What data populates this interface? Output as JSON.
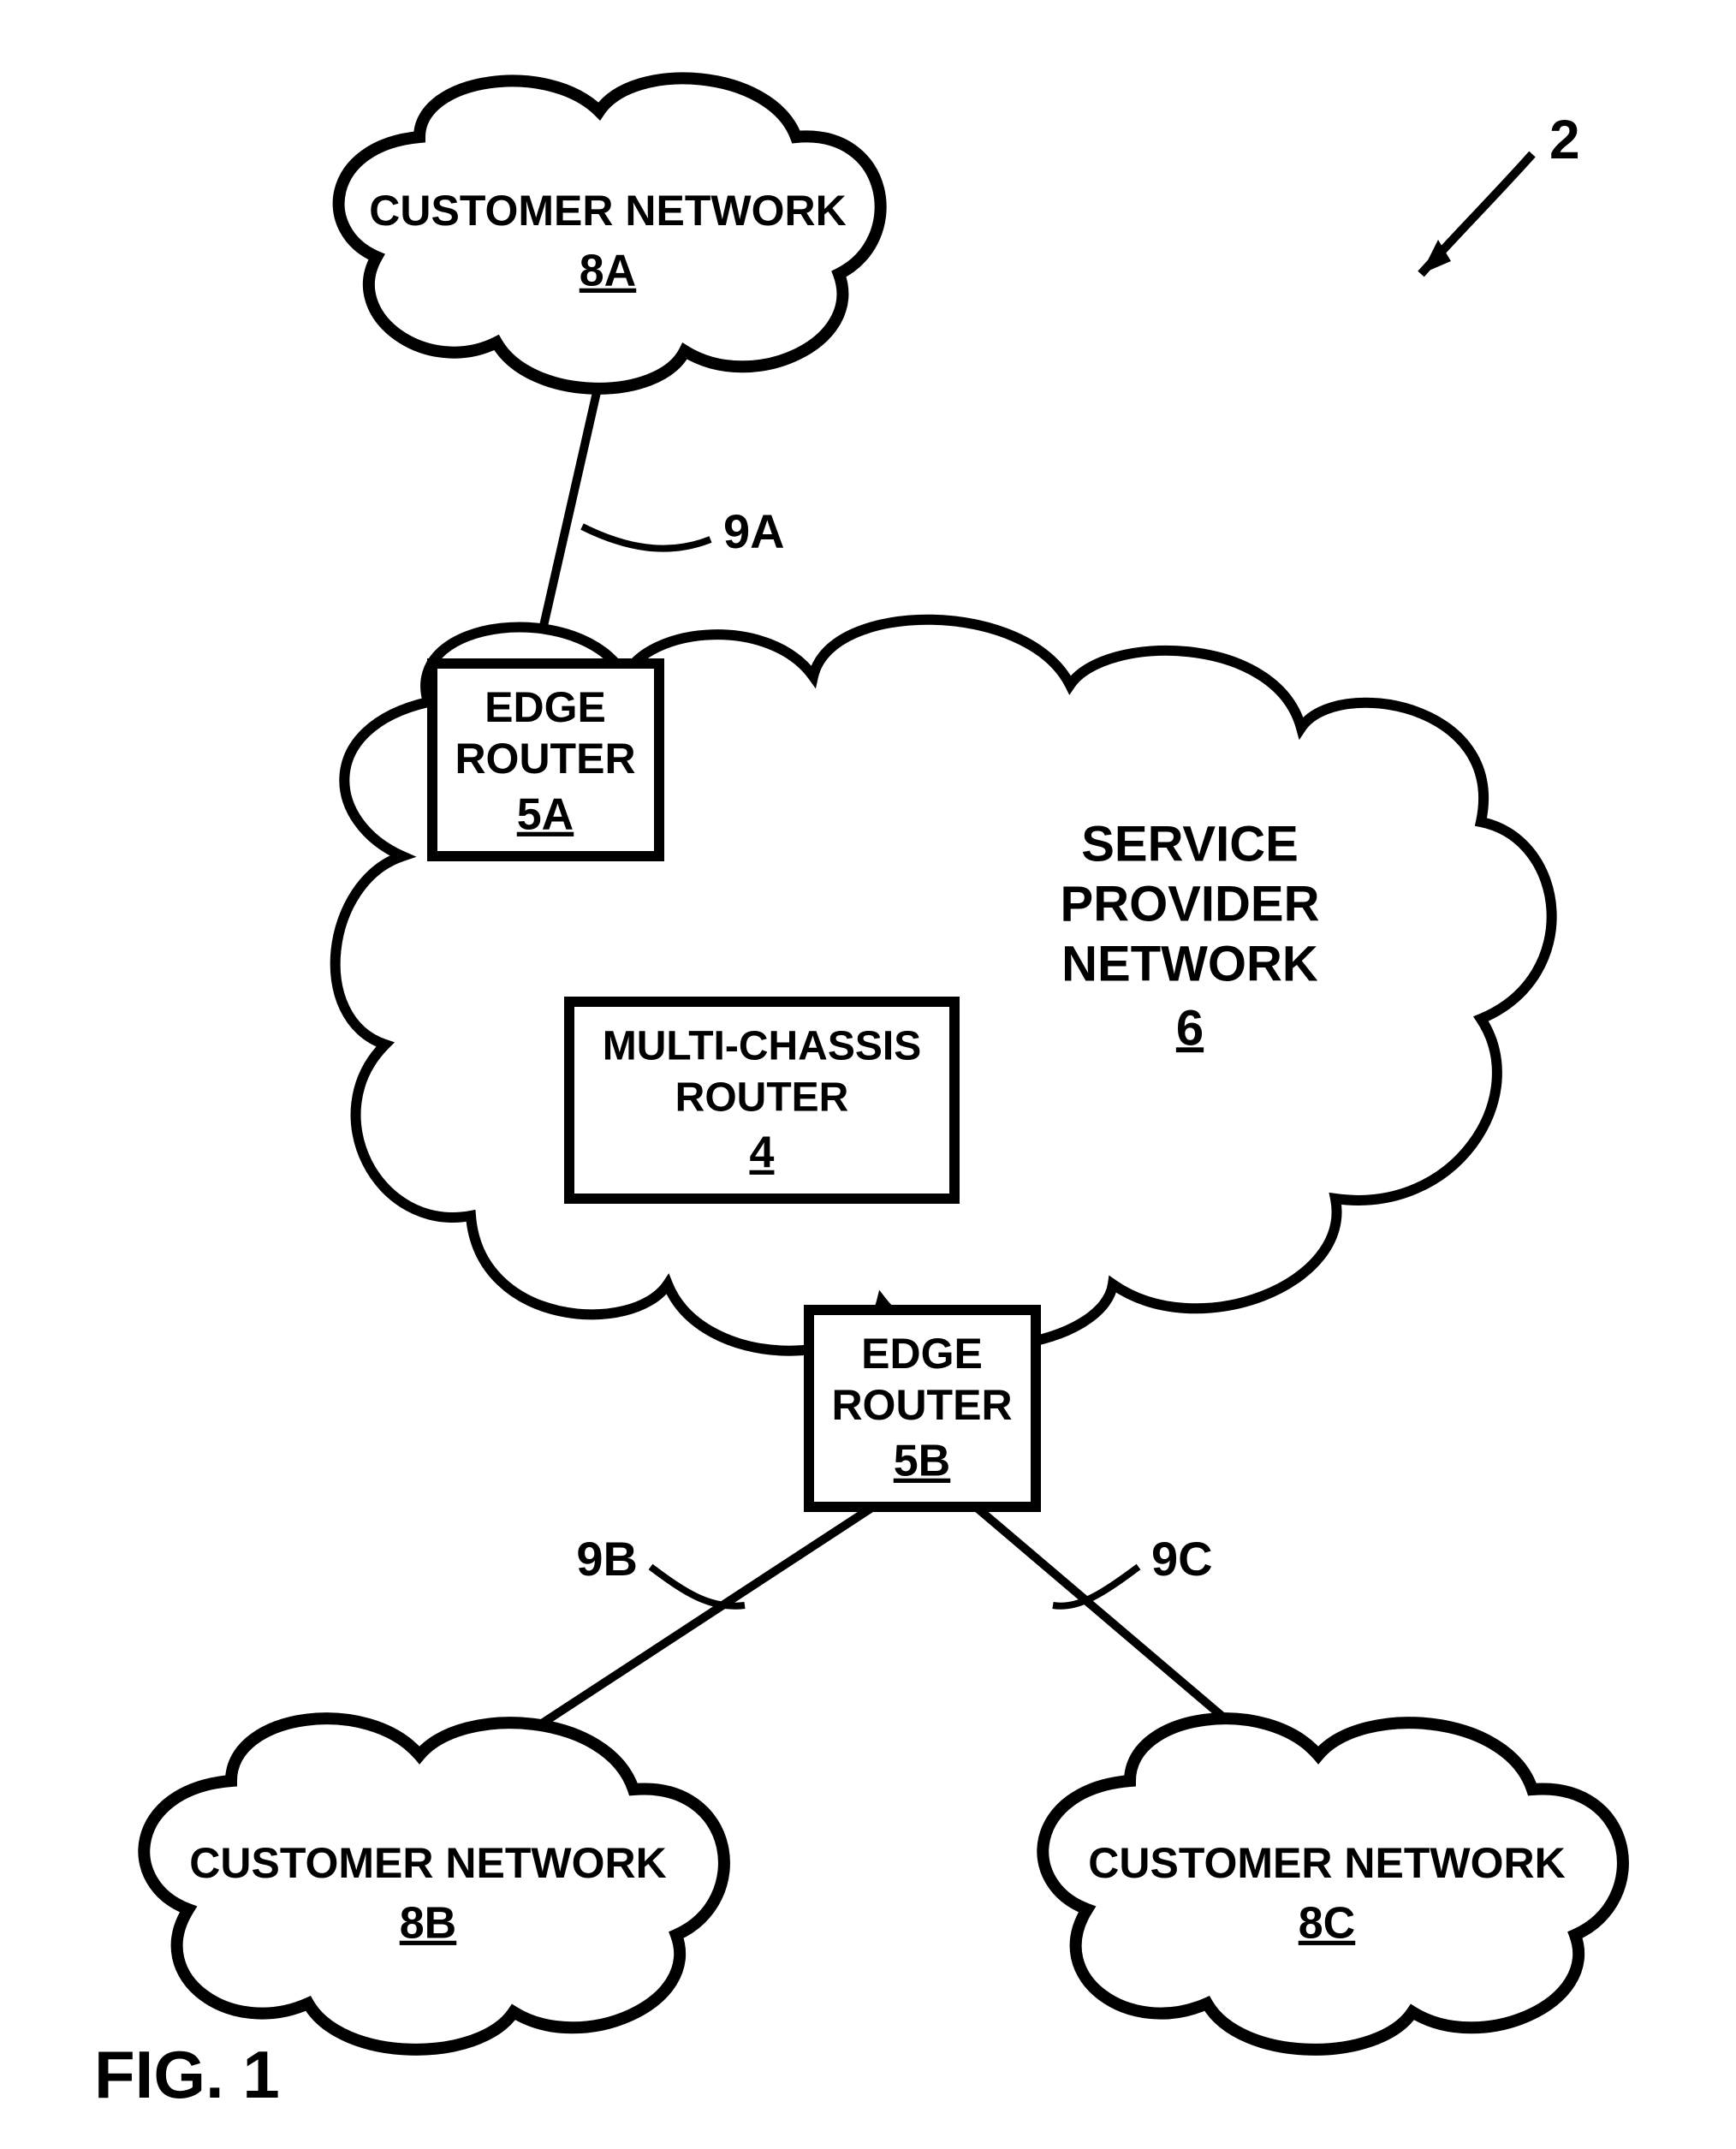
{
  "figure_label": "FIG. 1",
  "diagram_ref": "2",
  "clouds": {
    "cust_a": {
      "title": "CUSTOMER NETWORK",
      "ref": "8A"
    },
    "cust_b": {
      "title": "CUSTOMER NETWORK",
      "ref": "8B"
    },
    "cust_c": {
      "title": "CUSTOMER NETWORK",
      "ref": "8C"
    },
    "sp": {
      "line1": "SERVICE",
      "line2": "PROVIDER",
      "line3": "NETWORK",
      "ref": "6"
    }
  },
  "boxes": {
    "edge_a": {
      "line1": "EDGE",
      "line2": "ROUTER",
      "ref": "5A"
    },
    "edge_b": {
      "line1": "EDGE",
      "line2": "ROUTER",
      "ref": "5B"
    },
    "multi": {
      "line1": "MULTI-CHASSIS",
      "line2": "ROUTER",
      "ref": "4"
    }
  },
  "links": {
    "9a": "9A",
    "9b": "9B",
    "9c": "9C"
  }
}
